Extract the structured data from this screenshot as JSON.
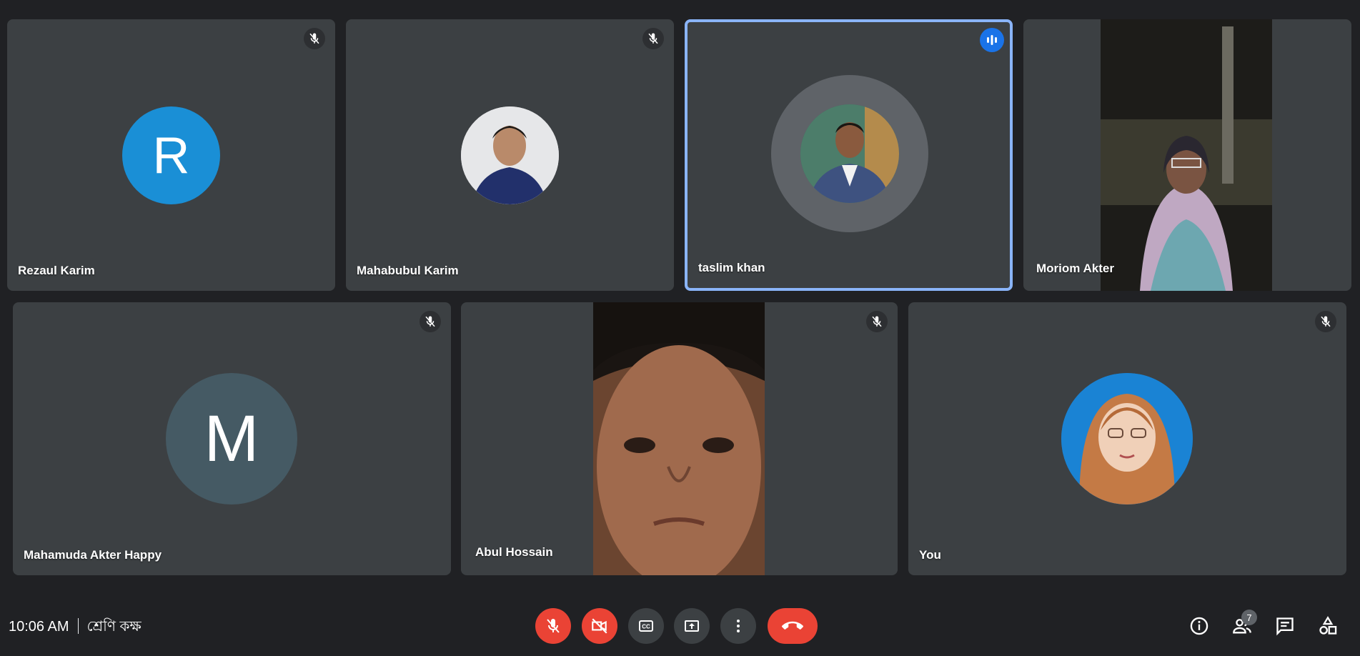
{
  "participants": [
    {
      "name": "Rezaul Karim",
      "avatar_letter": "R",
      "avatar_color": "#1a8fd6",
      "muted": true
    },
    {
      "name": "Mahabubul Karim",
      "muted": true
    },
    {
      "name": "taslim khan",
      "speaking": true
    },
    {
      "name": "Moriom Akter"
    },
    {
      "name": "Mahamuda Akter Happy",
      "avatar_letter": "M",
      "avatar_color": "#455a64",
      "muted": true
    },
    {
      "name": "Abul Hossain",
      "muted": true
    },
    {
      "name": "You",
      "muted": true
    }
  ],
  "meeting": {
    "time": "10:06 AM",
    "title": "শ্রেণি কক্ষ"
  },
  "controls": {
    "participant_count": "7"
  },
  "colors": {
    "background": "#202124",
    "tile": "#3c4043",
    "danger": "#ea4335",
    "active_border": "#8ab4f8",
    "accent": "#1a73e8"
  },
  "icons": [
    "mic-off-icon",
    "videocam-off-icon",
    "captions-icon",
    "present-icon",
    "more-vert-icon",
    "call-end-icon",
    "info-icon",
    "people-icon",
    "chat-icon",
    "activities-icon"
  ]
}
